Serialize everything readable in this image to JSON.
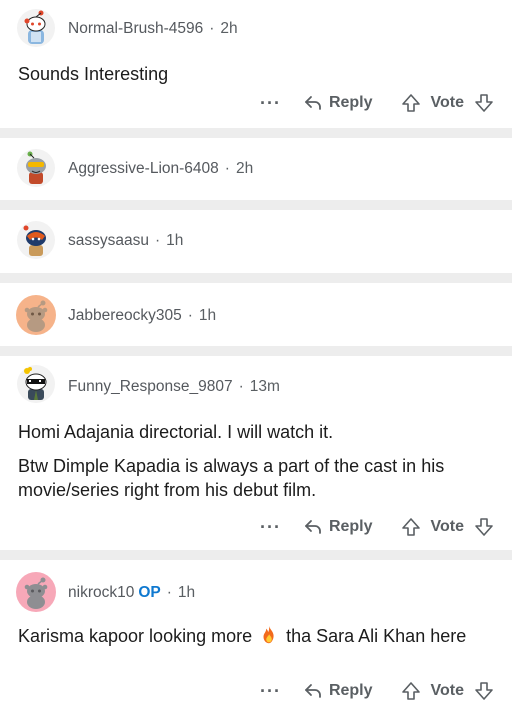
{
  "comments": [
    {
      "username": "Normal-Brush-4596",
      "time": "2h",
      "body": [
        "Sounds Interesting"
      ],
      "actions": {
        "more": "···",
        "reply": "Reply",
        "vote": "Vote"
      }
    },
    {
      "username": "Aggressive-Lion-6408",
      "time": "2h"
    },
    {
      "username": "sassysaasu",
      "time": "1h"
    },
    {
      "username": "Jabbereocky305",
      "time": "1h"
    },
    {
      "username": "Funny_Response_9807",
      "time": "13m",
      "body": [
        "Homi Adajania directorial. I will watch it.",
        "Btw Dimple Kapadia is always a part of the cast in his movie/series right from his debut film."
      ],
      "actions": {
        "more": "···",
        "reply": "Reply",
        "vote": "Vote"
      }
    },
    {
      "username": "nikrock10",
      "badge": "OP",
      "time": "1h",
      "body_before": "Karisma kapoor looking more",
      "emoji": "fire",
      "body_after": "tha Sara Ali Khan here",
      "actions": {
        "more": "···",
        "reply": "Reply",
        "vote": "Vote"
      }
    }
  ],
  "separator_dot": "·"
}
